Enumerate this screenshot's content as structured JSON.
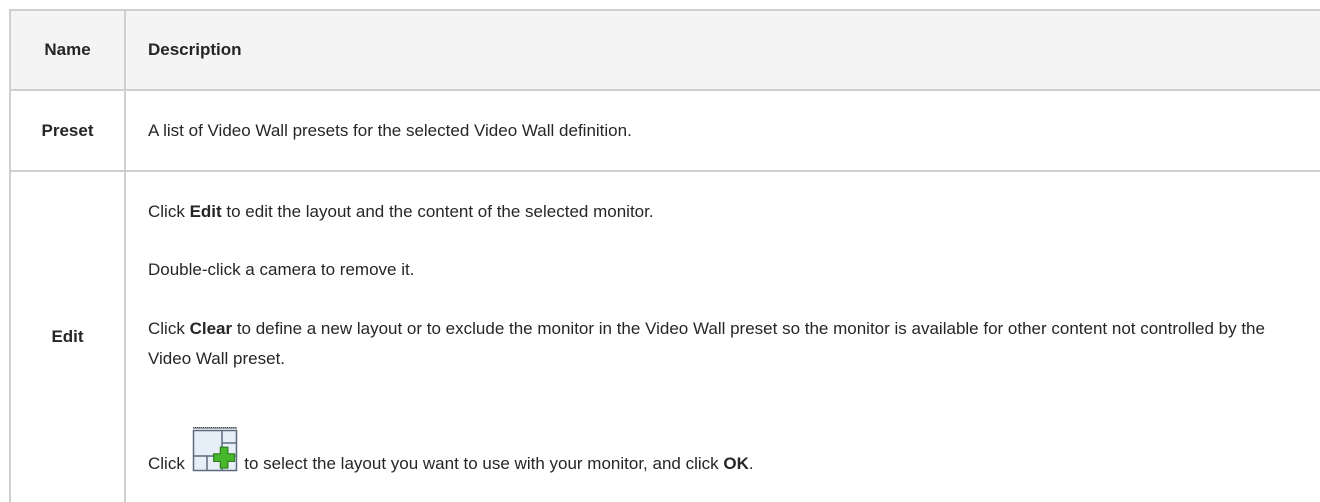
{
  "table": {
    "header": {
      "name": "Name",
      "description": "Description"
    },
    "rows": [
      {
        "name": "Preset",
        "description": "A list of Video Wall presets for the selected Video Wall definition."
      },
      {
        "name": "Edit",
        "p1": {
          "a": "Click ",
          "b": "Edit",
          "c": " to edit the layout and the content of the selected monitor."
        },
        "p2": "Double-click a camera to remove it.",
        "p3": {
          "a": "Click ",
          "b": "Clear",
          "c": " to define a new layout or to exclude the monitor in the Video Wall preset so the monitor is available for other content not controlled by the Video Wall preset."
        },
        "p4": {
          "a": "Click ",
          "icon": "layout-add-icon",
          "b": " to select the layout you want to use with your monitor, and click ",
          "c": "OK",
          "d": "."
        }
      }
    ]
  }
}
